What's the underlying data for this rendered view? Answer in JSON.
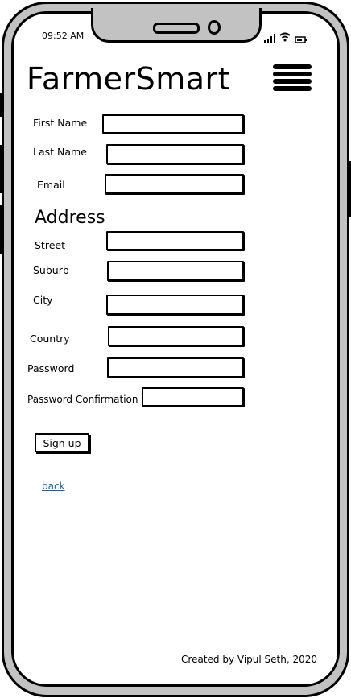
{
  "status_bar": {
    "time": "09:52 AM",
    "icons": [
      "signal-icon",
      "wifi-icon",
      "battery-icon"
    ]
  },
  "header": {
    "title": "FarmerSmart",
    "menu_icon": "hamburger-menu-icon"
  },
  "form": {
    "first_name": {
      "label": "First Name",
      "value": ""
    },
    "last_name": {
      "label": "Last Name",
      "value": ""
    },
    "email": {
      "label": "Email",
      "value": ""
    },
    "address_heading": "Address",
    "street": {
      "label": "Street",
      "value": ""
    },
    "suburb": {
      "label": "Suburb",
      "value": ""
    },
    "city": {
      "label": "City",
      "value": ""
    },
    "country": {
      "label": "Country",
      "value": ""
    },
    "password": {
      "label": "Password",
      "value": ""
    },
    "password_confirmation": {
      "label": "Password Confirmation",
      "value": ""
    },
    "signup_label": "Sign up",
    "back_label": "back"
  },
  "footer": {
    "credit": "Created by Vipul Seth, 2020"
  },
  "colors": {
    "link": "#1a5fa8",
    "frame": "#c2c2c2"
  }
}
